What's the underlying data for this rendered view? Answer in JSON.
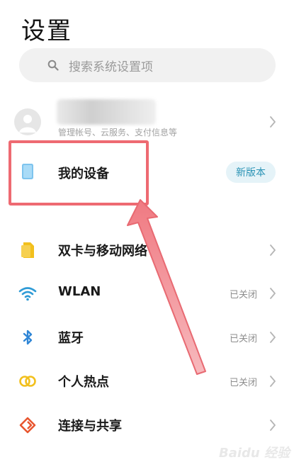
{
  "header": {
    "title": "设置"
  },
  "search": {
    "placeholder": "搜索系统设置项"
  },
  "account": {
    "subtitle": "管理帐号、云服务、支付信息等"
  },
  "device": {
    "label": "我的设备",
    "badge": "新版本"
  },
  "settings": [
    {
      "label": "双卡与移动网络",
      "status": "",
      "icon": "sim-card-icon",
      "color": "#f2c01d"
    },
    {
      "label": "WLAN",
      "status": "已关闭",
      "icon": "wifi-icon",
      "color": "#2f9bd6"
    },
    {
      "label": "蓝牙",
      "status": "已关闭",
      "icon": "bluetooth-icon",
      "color": "#2f86d6"
    },
    {
      "label": "个人热点",
      "status": "已关闭",
      "icon": "hotspot-icon",
      "color": "#f2c01d"
    },
    {
      "label": "连接与共享",
      "status": "",
      "icon": "share-icon",
      "color": "#e8562f"
    }
  ],
  "colors": {
    "highlight": "#ee6a72",
    "badge_bg": "#e5f3f8",
    "badge_text": "#2a93b5"
  },
  "watermark": "Baidu 经验"
}
